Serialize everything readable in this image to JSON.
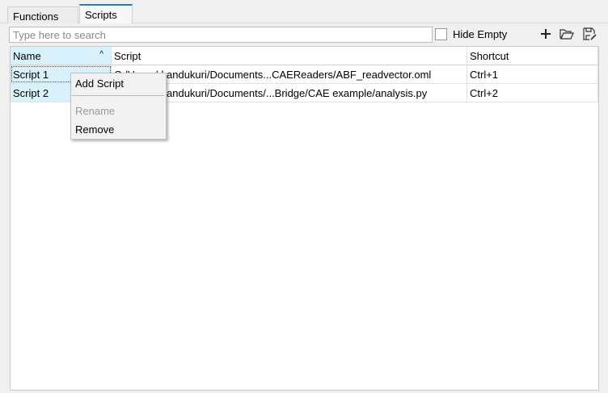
{
  "tabs": [
    {
      "label": "Functions"
    },
    {
      "label": "Scripts"
    }
  ],
  "search": {
    "placeholder": "Type here to search",
    "value": ""
  },
  "hide_empty": {
    "label": "Hide Empty",
    "checked": false
  },
  "toolbar": {
    "icons": [
      "plus-icon",
      "folder-open-icon",
      "save-edit-icon"
    ]
  },
  "table": {
    "columns": [
      "Name",
      "Script",
      "Shortcut"
    ],
    "rows": [
      {
        "name": "Script 1",
        "script": "C:/Users/rkandukuri/Documents...CAEReaders/ABF_readvector.oml",
        "shortcut": "Ctrl+1"
      },
      {
        "name": "Script 2",
        "script": "C:/Users/rkandukuri/Documents/...Bridge/CAE example/analysis.py",
        "shortcut": "Ctrl+2"
      }
    ]
  },
  "context_menu": {
    "items": [
      {
        "label": "Add Script",
        "enabled": true
      },
      {
        "label": "Rename",
        "enabled": false
      },
      {
        "label": "Remove",
        "enabled": true
      }
    ]
  }
}
